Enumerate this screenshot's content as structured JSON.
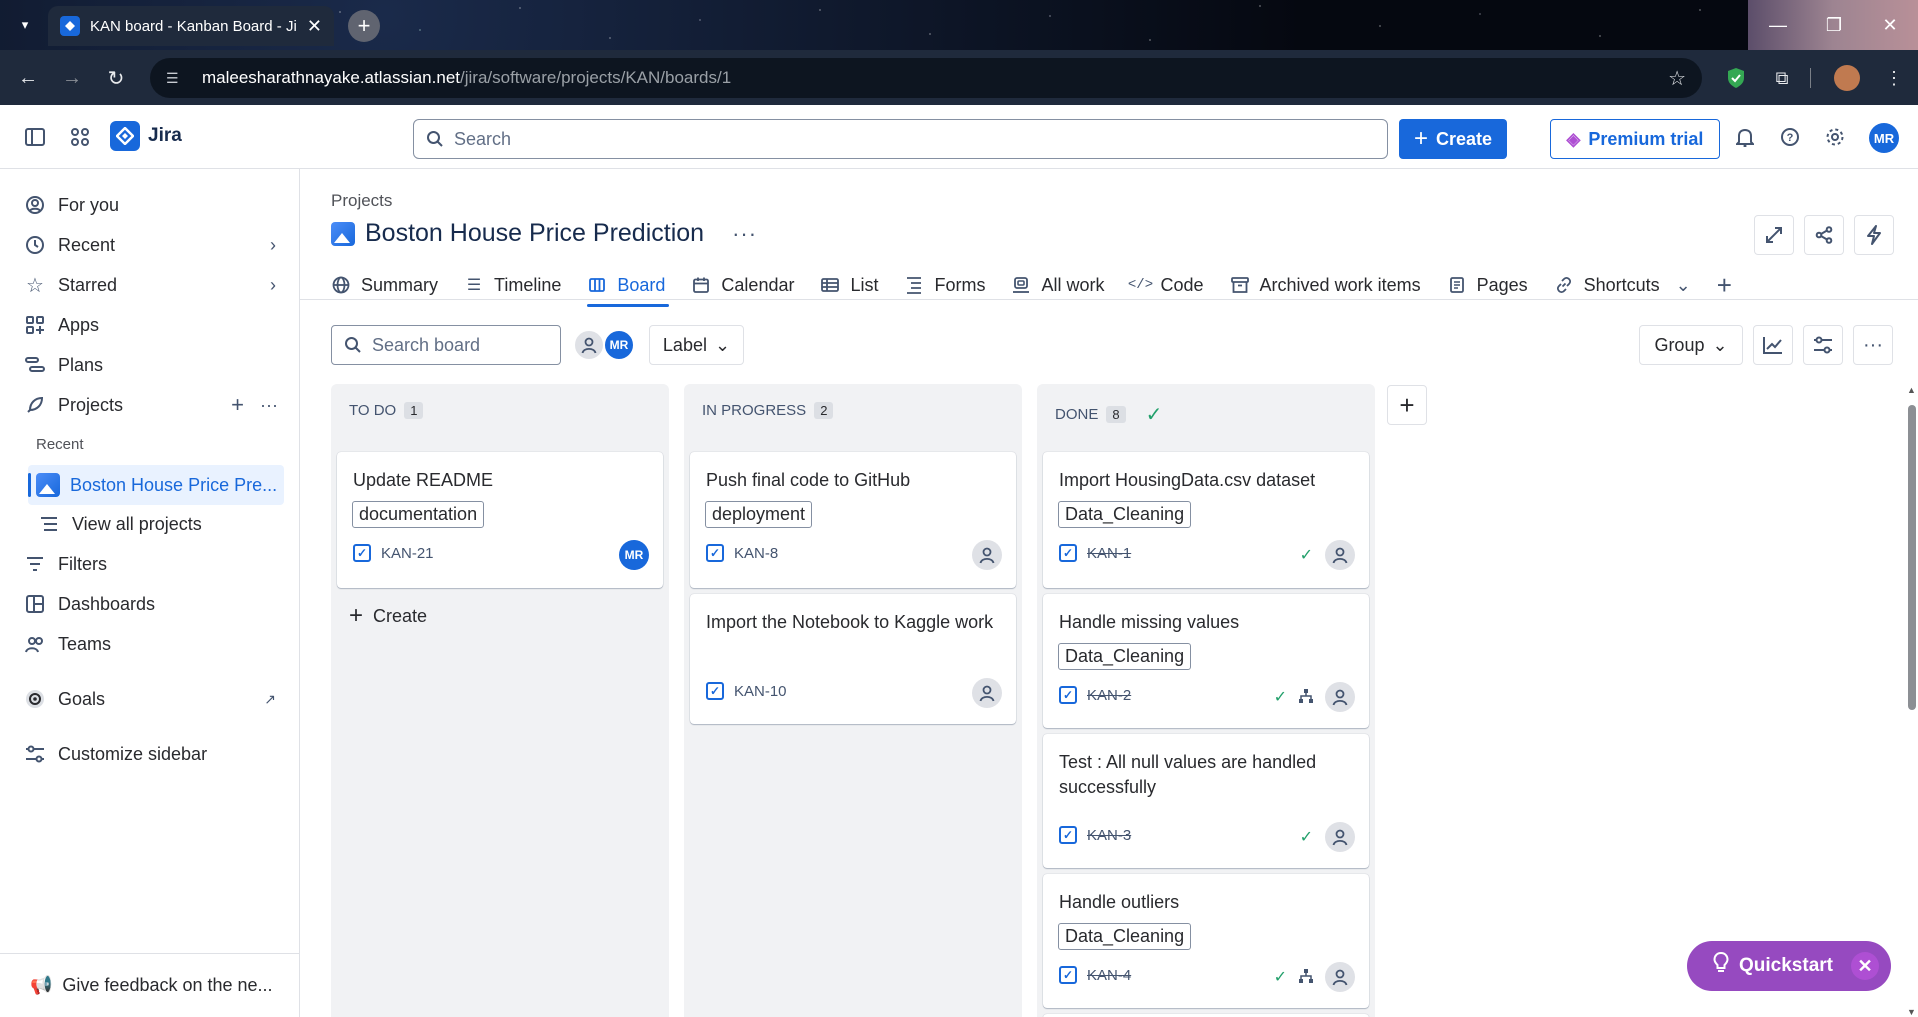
{
  "browser": {
    "tab_title": "KAN board - Kanban Board - Jir",
    "url_host": "maleesharathnayake.atlassian.net",
    "url_path": "/jira/software/projects/KAN/boards/1"
  },
  "topnav": {
    "app_name": "Jira",
    "search_placeholder": "Search",
    "create_label": "Create",
    "premium_label": "Premium trial",
    "avatar_initials": "MR"
  },
  "sidebar": {
    "items": [
      {
        "label": "For you",
        "icon": "user-circle-icon"
      },
      {
        "label": "Recent",
        "icon": "clock-icon"
      },
      {
        "label": "Starred",
        "icon": "star-icon"
      },
      {
        "label": "Apps",
        "icon": "apps-icon"
      },
      {
        "label": "Plans",
        "icon": "plans-icon"
      },
      {
        "label": "Projects",
        "icon": "rocket-icon"
      }
    ],
    "recent_heading": "Recent",
    "active_project": "Boston House Price Pre...",
    "view_all": "View all projects",
    "filters": "Filters",
    "dashboards": "Dashboards",
    "teams": "Teams",
    "goals": "Goals",
    "customize": "Customize sidebar",
    "feedback": "Give feedback on the ne..."
  },
  "project": {
    "breadcrumb": "Projects",
    "title": "Boston House Price Prediction",
    "more": "···"
  },
  "tabs": [
    {
      "label": "Summary",
      "icon": "globe-icon"
    },
    {
      "label": "Timeline",
      "icon": "timeline-icon"
    },
    {
      "label": "Board",
      "icon": "board-icon"
    },
    {
      "label": "Calendar",
      "icon": "calendar-icon"
    },
    {
      "label": "List",
      "icon": "list-icon"
    },
    {
      "label": "Forms",
      "icon": "forms-icon"
    },
    {
      "label": "All work",
      "icon": "all-work-icon"
    },
    {
      "label": "Code",
      "icon": "code-icon"
    },
    {
      "label": "Archived work items",
      "icon": "archive-icon"
    },
    {
      "label": "Pages",
      "icon": "pages-icon"
    },
    {
      "label": "Shortcuts",
      "icon": "link-icon"
    }
  ],
  "toolbar": {
    "search_placeholder": "Search board",
    "avatar_initials": "MR",
    "label_filter": "Label",
    "group": "Group"
  },
  "columns": [
    {
      "name": "TO DO",
      "count": "1",
      "cards": [
        {
          "title": "Update README",
          "label": "documentation",
          "key": "KAN-21",
          "assignee": "MR"
        }
      ],
      "create": "Create"
    },
    {
      "name": "IN PROGRESS",
      "count": "2",
      "cards": [
        {
          "title": "Push final code to GitHub",
          "label": "deployment",
          "key": "KAN-8"
        },
        {
          "title": "Import the Notebook to Kaggle work",
          "key": "KAN-10"
        }
      ]
    },
    {
      "name": "DONE",
      "count": "8",
      "cards": [
        {
          "title": "Import HousingData.csv dataset",
          "label": "Data_Cleaning",
          "key": "KAN-1"
        },
        {
          "title": "Handle missing values",
          "label": "Data_Cleaning",
          "key": "KAN-2"
        },
        {
          "title": "Test : All null values are handled successfully",
          "key": "KAN-3"
        },
        {
          "title": "Handle outliers",
          "label": "Data_Cleaning",
          "key": "KAN-4"
        }
      ]
    }
  ],
  "quickstart": "Quickstart",
  "colors": {
    "primary": "#1868db",
    "done": "#22a06b",
    "quickstart": "#964ac0"
  }
}
